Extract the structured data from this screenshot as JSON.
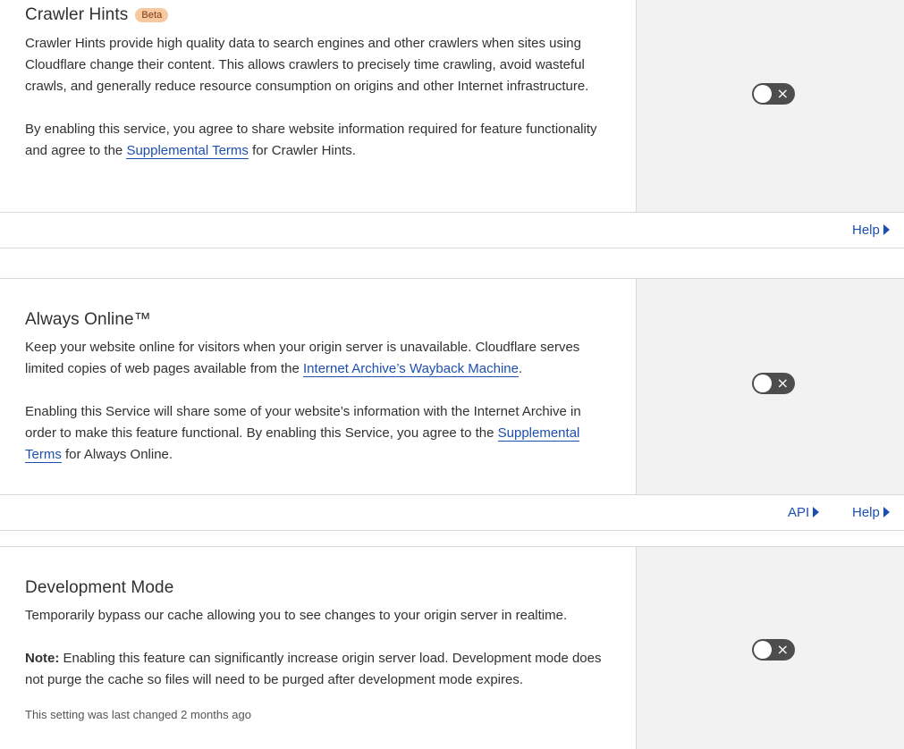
{
  "crawler_hints": {
    "title": "Crawler Hints",
    "badge": "Beta",
    "para1": "Crawler Hints provide high quality data to search engines and other crawlers when sites using Cloudflare change their content. This allows crawlers to precisely time crawling, avoid wasteful crawls, and generally reduce resource consumption on origins and other Internet infrastructure.",
    "para2_before": "By enabling this service, you agree to share website information required for feature functionality and agree to the ",
    "para2_link": "Supplemental Terms",
    "para2_after": " for Crawler Hints.",
    "toggle_state": "off",
    "help_label": "Help"
  },
  "always_online": {
    "title": "Always Online™",
    "para1_before": "Keep your website online for visitors when your origin server is unavailable. Cloudflare serves limited copies of web pages available from the ",
    "para1_link": "Internet Archive’s Wayback Machine",
    "para1_after": ".",
    "para2_before": "Enabling this Service will share some of your website’s information with the Internet Archive in order to make this feature functional. By enabling this Service, you agree to the ",
    "para2_link": "Supplemental Terms",
    "para2_after": " for Always Online.",
    "toggle_state": "off",
    "api_label": "API",
    "help_label": "Help"
  },
  "development_mode": {
    "title": "Development Mode",
    "para1": "Temporarily bypass our cache allowing you to see changes to your origin server in realtime.",
    "note_label": "Note:",
    "note_text": " Enabling this feature can significantly increase origin server load. Development mode does not purge the cache so files will need to be purged after development mode expires.",
    "last_changed": "This setting was last changed 2 months ago",
    "toggle_state": "off"
  },
  "icons": {
    "toggle_off": "×",
    "chevron": "triangle-right"
  }
}
